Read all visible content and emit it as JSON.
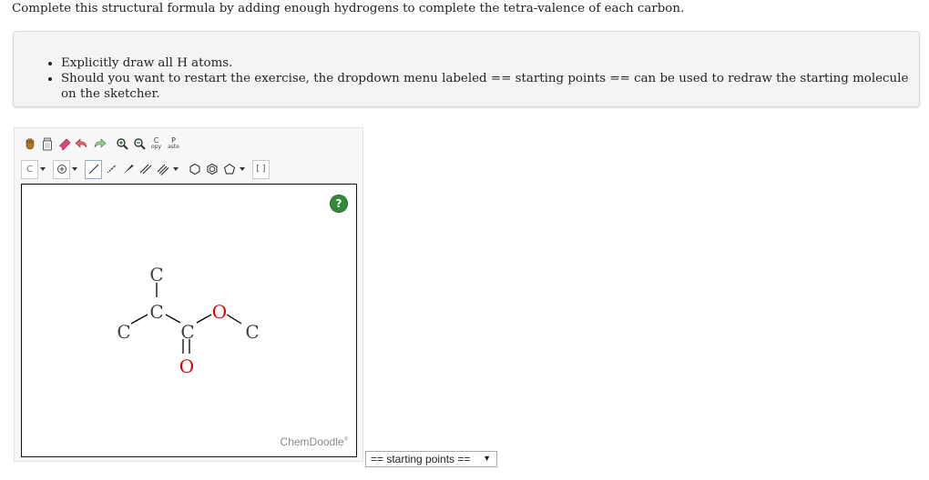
{
  "instruction": "Complete this structural formula by adding enough hydrogens to complete the tetra-valence of each carbon.",
  "notes": [
    "Explicitly draw all H atoms.",
    "Should you want to restart the exercise, the dropdown menu labeled == starting points == can be used to redraw the starting molecule on the sketcher."
  ],
  "toolbar": {
    "copy_top": "C",
    "copy_bottom": "opy",
    "paste_top": "P",
    "paste_bottom": "aste",
    "atom_label": "C",
    "template_label": "[ ]",
    "icons": [
      "hand-icon",
      "clear-icon",
      "eraser-icon",
      "undo-icon",
      "redo-icon",
      "zoom-in-icon",
      "zoom-out-icon",
      "charge-icon",
      "single-bond-icon",
      "wedge-bond-icon",
      "double-bond-icon",
      "triple-bond-icon",
      "ring-icon",
      "benzene-icon",
      "pentagon-icon"
    ]
  },
  "help_label": "?",
  "brand": "ChemDoodle",
  "brand_mark": "®",
  "molecule": {
    "atoms": [
      "C",
      "C",
      "C",
      "C",
      "O",
      "C",
      "O"
    ],
    "atom_colors": {
      "C": "#404040",
      "O": "#e00000"
    }
  },
  "starting_points": {
    "selected": "== starting points ==",
    "arrow": "▼"
  }
}
